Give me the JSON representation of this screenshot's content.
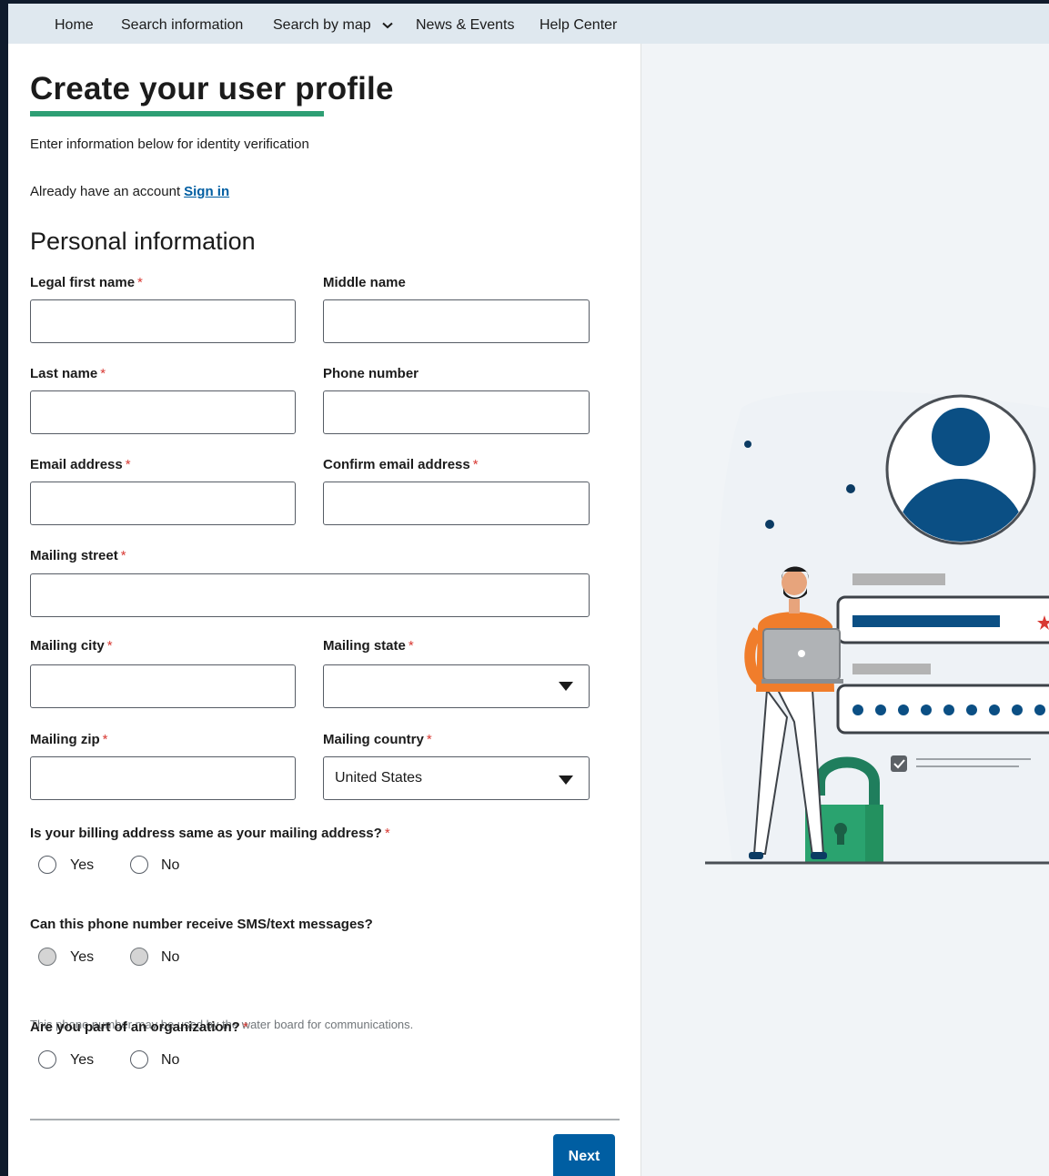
{
  "nav": {
    "items": [
      {
        "label": "Home"
      },
      {
        "label": "Search information"
      },
      {
        "label": "Search by map"
      },
      {
        "label": "News & Events"
      },
      {
        "label": "Help Center"
      }
    ]
  },
  "page": {
    "title": "Create your user profile",
    "subtitle": "Enter information below for identity verification",
    "account_prompt": "Already have an account",
    "signin_link": "Sign in",
    "section_title": "Personal information"
  },
  "form": {
    "first_name_label": "Legal first name",
    "middle_name_label": "Middle name",
    "last_name_label": "Last name",
    "phone_label": "Phone number",
    "email_label": "Email address",
    "confirm_email_label": "Confirm email address",
    "street_label": "Mailing street",
    "city_label": "Mailing city",
    "state_label": "Mailing state",
    "zip_label": "Mailing zip",
    "country_label": "Mailing country",
    "country_value": "United States",
    "state_value": "",
    "required_mark": "*"
  },
  "questions": {
    "billing": {
      "text": "Is your billing address same as your mailing address?",
      "yes": "Yes",
      "no": "No"
    },
    "sms": {
      "text": "Can this phone number receive SMS/text messages?",
      "yes": "Yes",
      "no": "No",
      "hint": "This phone number may be used by the water board for communications."
    },
    "org": {
      "text": "Are you part of an organization?",
      "yes": "Yes",
      "no": "No"
    }
  },
  "actions": {
    "next_label": "Next"
  },
  "colors": {
    "primary": "#005ea2",
    "accent_bar": "#2e9f74",
    "required": "#d83933",
    "nav_bg": "#dfe8ef"
  }
}
